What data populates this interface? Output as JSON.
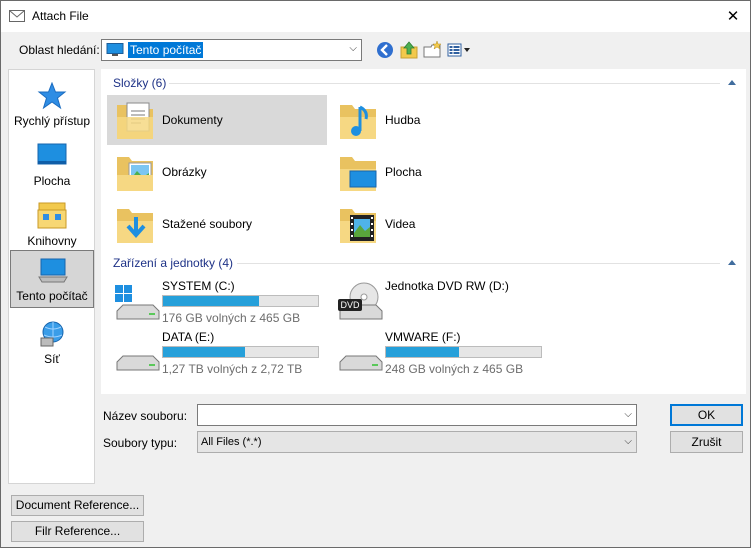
{
  "window": {
    "title": "Attach File",
    "close_glyph": "✕"
  },
  "lookin": {
    "label": "Oblast hledání:",
    "value": "Tento počítač",
    "arrow": "⌵"
  },
  "toolbar": {
    "icons": [
      "back-icon",
      "up-folder-icon",
      "new-folder-icon",
      "view-menu-icon"
    ]
  },
  "places": [
    {
      "label": "Rychlý přístup",
      "icon": "star-icon"
    },
    {
      "label": "Plocha",
      "icon": "desktop-icon"
    },
    {
      "label": "Knihovny",
      "icon": "libraries-icon"
    },
    {
      "label": "Tento počítač",
      "icon": "computer-icon",
      "selected": true
    },
    {
      "label": "Síť",
      "icon": "network-icon"
    }
  ],
  "folders": {
    "header": "Složky (6)",
    "items": [
      {
        "name": "Dokumenty",
        "icon": "documents-folder-icon",
        "selected": true
      },
      {
        "name": "Hudba",
        "icon": "music-folder-icon"
      },
      {
        "name": "Obrázky",
        "icon": "pictures-folder-icon"
      },
      {
        "name": "Plocha",
        "icon": "desktop-folder-icon"
      },
      {
        "name": "Stažené soubory",
        "icon": "downloads-folder-icon"
      },
      {
        "name": "Videa",
        "icon": "videos-folder-icon"
      }
    ]
  },
  "drives": {
    "header": "Zařízení a jednotky (4)",
    "items": [
      {
        "name": "SYSTEM (C:)",
        "free": "176 GB volných z 465 GB",
        "used_fraction": 0.62,
        "icon": "system-drive-icon"
      },
      {
        "name": "Jednotka DVD RW (D:)",
        "free": "",
        "used_fraction": null,
        "icon": "dvd-drive-icon"
      },
      {
        "name": "DATA (E:)",
        "free": "1,27 TB volných z 2,72 TB",
        "used_fraction": 0.53,
        "icon": "hard-drive-icon"
      },
      {
        "name": "VMWARE (F:)",
        "free": "248 GB volných z 465 GB",
        "used_fraction": 0.47,
        "icon": "hard-drive-icon"
      }
    ]
  },
  "filename": {
    "label": "Název souboru:",
    "value": ""
  },
  "filetype": {
    "label": "Soubory typu:",
    "value": "All Files (*.*)"
  },
  "buttons": {
    "ok": "OK",
    "cancel": "Zrušit",
    "doc_ref": "Document Reference...",
    "file_ref": "Filr Reference..."
  },
  "colors": {
    "accent": "#0078d7",
    "bar_fill": "#26a0da",
    "group_header": "#1e3287"
  }
}
